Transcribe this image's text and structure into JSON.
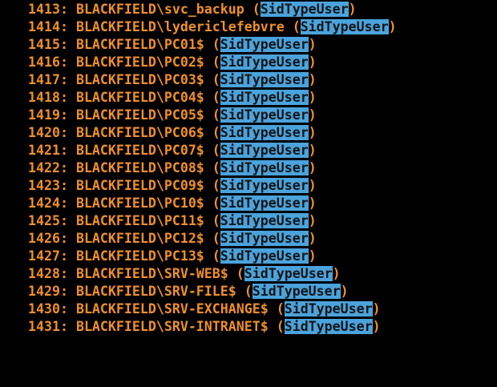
{
  "colors": {
    "background": "#000000",
    "text": "#f0902a",
    "highlight_bg": "#4aa3dc",
    "highlight_text": "#141414"
  },
  "lines": [
    {
      "num": "1413:",
      "account": "BLACKFIELD\\svc_backup",
      "type": "SidTypeUser"
    },
    {
      "num": "1414:",
      "account": "BLACKFIELD\\lydericlefebvre",
      "type": "SidTypeUser"
    },
    {
      "num": "1415:",
      "account": "BLACKFIELD\\PC01$",
      "type": "SidTypeUser"
    },
    {
      "num": "1416:",
      "account": "BLACKFIELD\\PC02$",
      "type": "SidTypeUser"
    },
    {
      "num": "1417:",
      "account": "BLACKFIELD\\PC03$",
      "type": "SidTypeUser"
    },
    {
      "num": "1418:",
      "account": "BLACKFIELD\\PC04$",
      "type": "SidTypeUser"
    },
    {
      "num": "1419:",
      "account": "BLACKFIELD\\PC05$",
      "type": "SidTypeUser"
    },
    {
      "num": "1420:",
      "account": "BLACKFIELD\\PC06$",
      "type": "SidTypeUser"
    },
    {
      "num": "1421:",
      "account": "BLACKFIELD\\PC07$",
      "type": "SidTypeUser"
    },
    {
      "num": "1422:",
      "account": "BLACKFIELD\\PC08$",
      "type": "SidTypeUser"
    },
    {
      "num": "1423:",
      "account": "BLACKFIELD\\PC09$",
      "type": "SidTypeUser"
    },
    {
      "num": "1424:",
      "account": "BLACKFIELD\\PC10$",
      "type": "SidTypeUser"
    },
    {
      "num": "1425:",
      "account": "BLACKFIELD\\PC11$",
      "type": "SidTypeUser"
    },
    {
      "num": "1426:",
      "account": "BLACKFIELD\\PC12$",
      "type": "SidTypeUser"
    },
    {
      "num": "1427:",
      "account": "BLACKFIELD\\PC13$",
      "type": "SidTypeUser"
    },
    {
      "num": "1428:",
      "account": "BLACKFIELD\\SRV-WEB$",
      "type": "SidTypeUser"
    },
    {
      "num": "1429:",
      "account": "BLACKFIELD\\SRV-FILE$",
      "type": "SidTypeUser"
    },
    {
      "num": "1430:",
      "account": "BLACKFIELD\\SRV-EXCHANGE$",
      "type": "SidTypeUser"
    },
    {
      "num": "1431:",
      "account": "BLACKFIELD\\SRV-INTRANET$",
      "type": "SidTypeUser"
    }
  ]
}
